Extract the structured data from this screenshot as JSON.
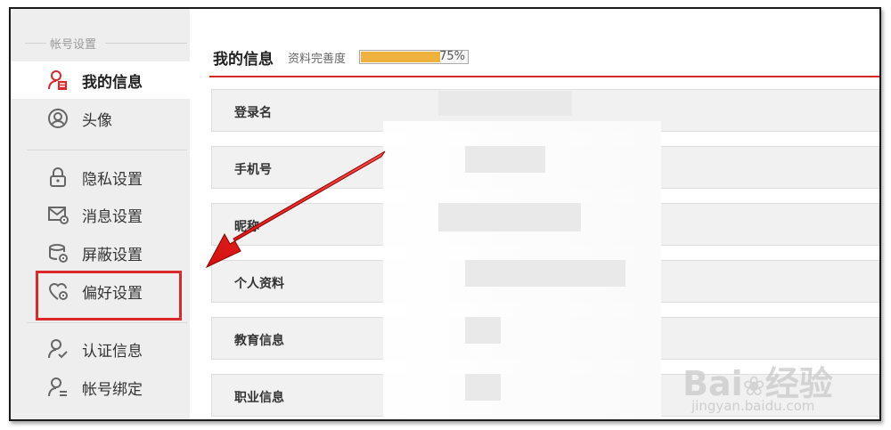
{
  "sidebar": {
    "section_label": "帐号设置",
    "items": [
      {
        "label": "我的信息",
        "icon": "user-doc-icon",
        "active": true
      },
      {
        "label": "头像",
        "icon": "avatar-circle-icon"
      },
      {
        "label": "隐私设置",
        "icon": "lock-icon"
      },
      {
        "label": "消息设置",
        "icon": "message-gear-icon"
      },
      {
        "label": "屏蔽设置",
        "icon": "block-gear-icon"
      },
      {
        "label": "偏好设置",
        "icon": "heart-gear-icon"
      },
      {
        "label": "认证信息",
        "icon": "user-verify-icon"
      },
      {
        "label": "帐号绑定",
        "icon": "user-bind-icon"
      }
    ]
  },
  "main": {
    "title": "我的信息",
    "completeness_label": "资料完善度",
    "completeness_percent": "75%",
    "completeness_value": 0.75,
    "rows": [
      {
        "label": "登录名"
      },
      {
        "label": "手机号"
      },
      {
        "label": "昵称"
      },
      {
        "label": "个人资料"
      },
      {
        "label": "教育信息"
      },
      {
        "label": "职业信息"
      }
    ]
  },
  "annotation": {
    "highlight_color": "#d9292b",
    "arrow_color": "#e02020"
  },
  "watermark": {
    "brand": "Bai",
    "suffix": "经验",
    "url": "jingyan.baidu.com"
  },
  "colors": {
    "accent": "#d9292b",
    "progress": "#f0b23e"
  }
}
